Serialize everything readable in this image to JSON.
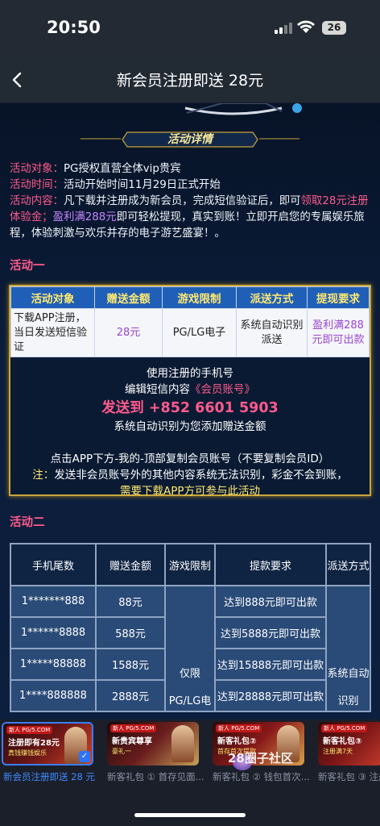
{
  "status": {
    "time": "20:50",
    "battery": "26"
  },
  "nav": {
    "title": "新会员注册即送 28元"
  },
  "banner": {
    "ribbon": "活动详情"
  },
  "info": {
    "target_k": "活动对象：",
    "target_v": "PG授权直营全体vip贵宾",
    "time_k": "活动时间：",
    "time_v": "活动开始时间11月29日正式开始",
    "content_k": "活动内容：",
    "content_a": "凡下载并注册成为新会员，完成短信验证后，即可",
    "content_hl": "领取28元注册体验金；",
    "content_pu": "盈利满288元",
    "content_b": "即可轻松提现，真实到账！立即开启您的专属娱乐旅程，体验刺激与欢乐并存的电子游艺盛宴！。"
  },
  "section1": {
    "title": "活动一",
    "headers": [
      "活动对象",
      "赠送金额",
      "游戏限制",
      "派送方式",
      "提现要求"
    ],
    "row": [
      "下载APP注册，当日发送短信验证",
      "28元",
      "PG/LG电子",
      "系统自动识别派送",
      "盈利满288元即可出款"
    ],
    "line1": "使用注册的手机号",
    "line2_a": "编辑短信内容",
    "line2_b": "《会员账号》",
    "send": "发送到 +852 6601 5903",
    "line3": "系统自动识别为您添加赠送金额",
    "line4": "点击APP下方-我的-顶部复制会员账号（不要复制会员ID）",
    "note_k": "注：",
    "note_v": "发送非会员账号外的其他内容系统无法识别，彩金不会到账，",
    "note2": "需要下载APP方可参与此活动"
  },
  "section2": {
    "title": "活动二",
    "headers": [
      "手机尾数",
      "赠送金额",
      "游戏限制",
      "提款要求",
      "派送方式"
    ],
    "rows": [
      {
        "tail": "1*******888",
        "amount": "88元",
        "req": "达到888元即可出款"
      },
      {
        "tail": "1******8888",
        "amount": "588元",
        "req": "达到5888元即可出款"
      },
      {
        "tail": "1*****88888",
        "amount": "1588元",
        "req": "达到15888元即可出款"
      },
      {
        "tail": "1****888888",
        "amount": "2888元",
        "req": "达到28888元即可出款"
      }
    ],
    "limit": "仅限\n\nPG/LG电",
    "dispatch": "系统自动\n\n识别"
  },
  "carousel": {
    "cards": [
      {
        "tag": "新人 PG/5.COM",
        "head": "注册即有28元",
        "sub": "真钱赚钱娱乐",
        "caption": "新会员注册即送 28 元"
      },
      {
        "tag": "新人 PG/5.COM",
        "head": "新贵宾尊享",
        "sub": "豪礼一",
        "caption": "新客礼包 ① 首存见面..."
      },
      {
        "tag": "新人 PG/5.COM",
        "head": "新客礼包②",
        "sub": "首存首次提取",
        "caption": "新客礼包 ② 钱包首次..."
      },
      {
        "tag": "新人 PG/5.COM",
        "head": "新客礼包③",
        "sub": "注册满7天",
        "caption": "新客礼包 ③ 注册..."
      }
    ],
    "watermark": "28圈子社区"
  },
  "colors": {
    "accent": "#ff5a8c",
    "gold": "#ffe970",
    "blue_header": "#1f5fb8"
  }
}
